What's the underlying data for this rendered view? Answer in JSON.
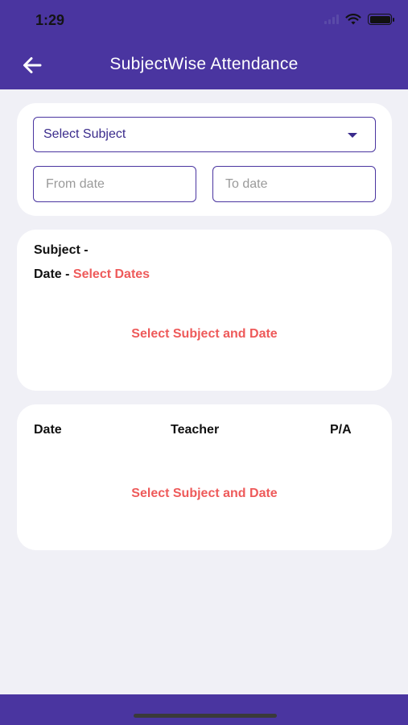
{
  "status": {
    "time": "1:29"
  },
  "header": {
    "title": "SubjectWise Attendance",
    "back_icon": "arrow-left-icon"
  },
  "filters": {
    "subject_select": {
      "value": "Select Subject"
    },
    "from_date": {
      "placeholder": "From date"
    },
    "to_date": {
      "placeholder": "To date"
    }
  },
  "summary": {
    "subject_label": "Subject -",
    "date_label": "Date - ",
    "date_hint": "Select Dates",
    "message": "Select Subject and Date"
  },
  "records": {
    "columns": [
      "Date",
      "Teacher",
      "P/A"
    ],
    "message": "Select Subject and Date"
  },
  "colors": {
    "primary": "#4a35a0",
    "accent": "#ee5a5a",
    "background": "#f0f0f6"
  }
}
